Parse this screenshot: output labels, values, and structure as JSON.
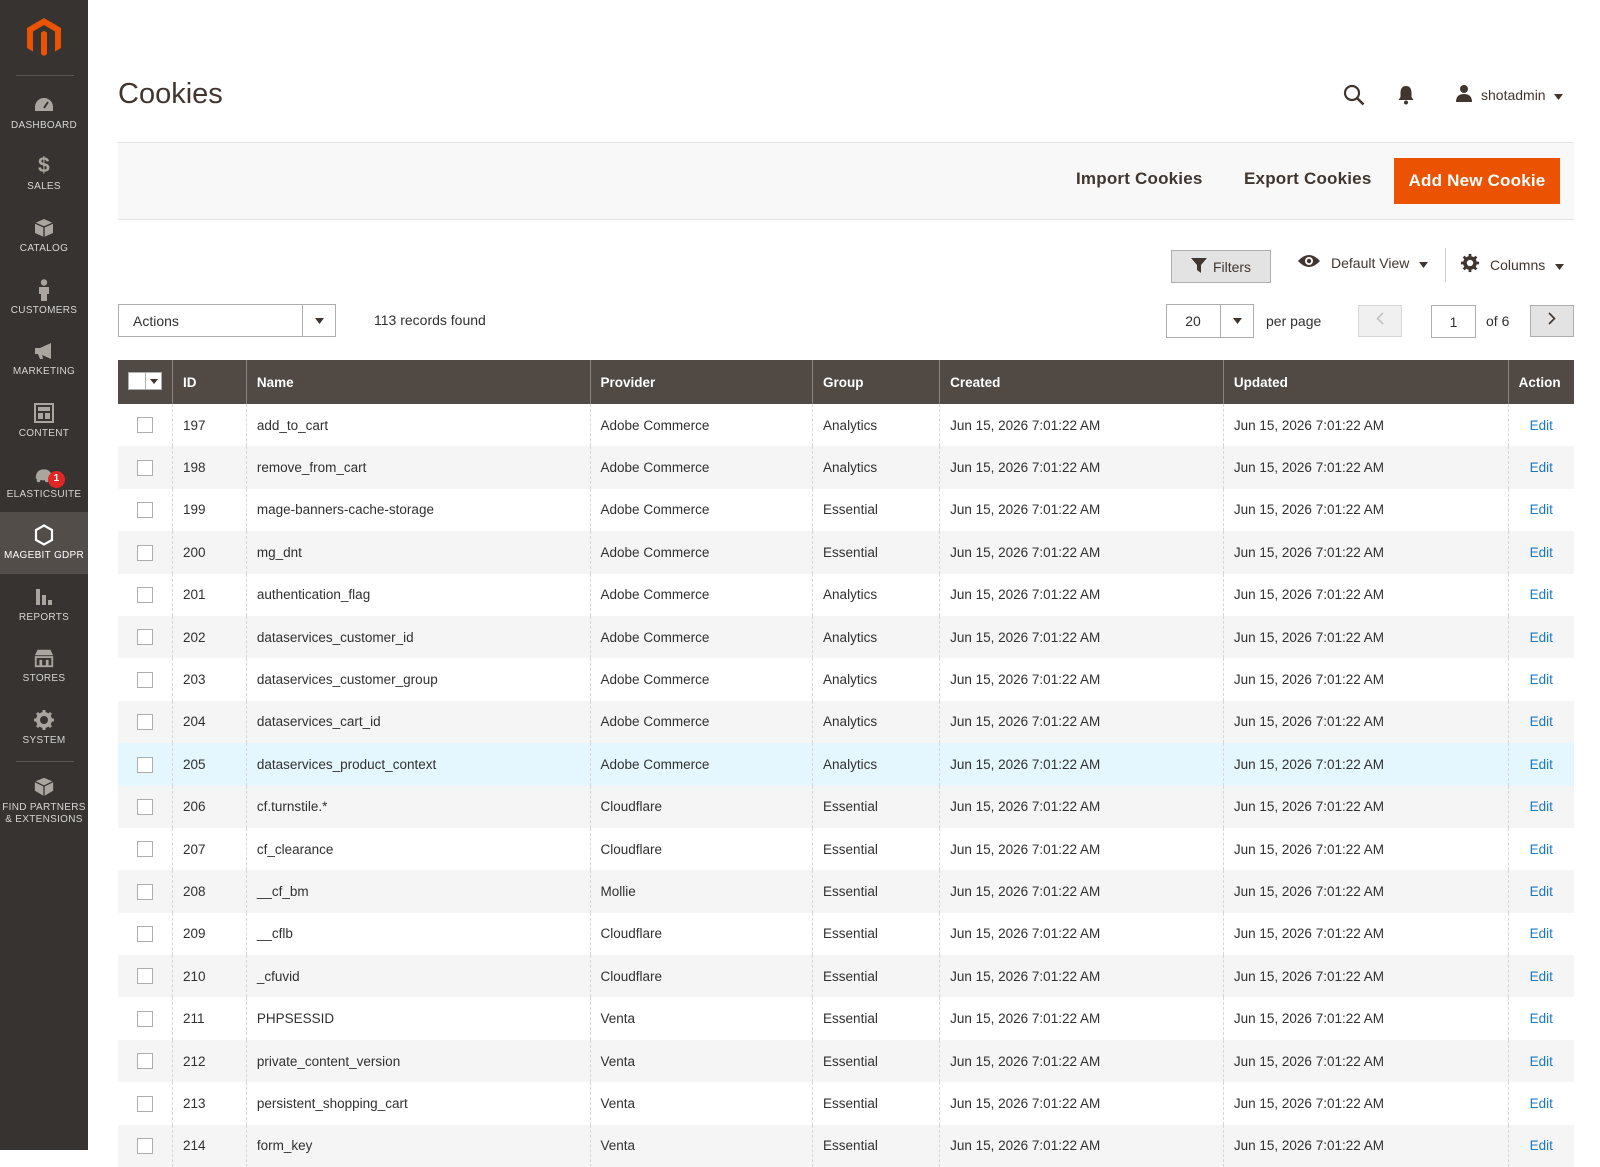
{
  "sidebar": {
    "items": [
      {
        "label": "DASHBOARD",
        "icon": "dashboard-icon"
      },
      {
        "label": "SALES",
        "icon": "dollar-icon"
      },
      {
        "label": "CATALOG",
        "icon": "box-icon"
      },
      {
        "label": "CUSTOMERS",
        "icon": "person-icon"
      },
      {
        "label": "MARKETING",
        "icon": "megaphone-icon"
      },
      {
        "label": "CONTENT",
        "icon": "layout-icon"
      },
      {
        "label": "ELASTICSUITE",
        "icon": "elasticsuite-icon",
        "badge": "1"
      },
      {
        "label": "MAGEBIT GDPR",
        "icon": "hexagon-icon"
      },
      {
        "label": "REPORTS",
        "icon": "bar-chart-icon"
      },
      {
        "label": "STORES",
        "icon": "store-icon"
      },
      {
        "label": "SYSTEM",
        "icon": "gear-icon"
      },
      {
        "label": "FIND PARTNERS\n& EXTENSIONS",
        "icon": "boxes-icon"
      }
    ]
  },
  "header": {
    "title": "Cookies",
    "user": "shotadmin"
  },
  "actions": {
    "import": "Import Cookies",
    "export": "Export Cookies",
    "add_new": "Add New Cookie"
  },
  "toolbar": {
    "filters": "Filters",
    "view": "Default View",
    "columns": "Columns",
    "mass_actions": "Actions",
    "records": "113 records found",
    "per_page_value": "20",
    "per_page_label": "per page",
    "page": "1",
    "of_pages": "of 6"
  },
  "grid": {
    "columns": [
      "ID",
      "Name",
      "Provider",
      "Group",
      "Created",
      "Updated",
      "Action"
    ],
    "rows": [
      {
        "id": "197",
        "name": "add_to_cart",
        "provider": "Adobe Commerce",
        "group": "Analytics",
        "created": "Jun 15, 2026 7:01:22 AM",
        "updated": "Jun 15, 2026 7:01:22 AM",
        "action": "Edit"
      },
      {
        "id": "198",
        "name": "remove_from_cart",
        "provider": "Adobe Commerce",
        "group": "Analytics",
        "created": "Jun 15, 2026 7:01:22 AM",
        "updated": "Jun 15, 2026 7:01:22 AM",
        "action": "Edit"
      },
      {
        "id": "199",
        "name": "mage-banners-cache-storage",
        "provider": "Adobe Commerce",
        "group": "Essential",
        "created": "Jun 15, 2026 7:01:22 AM",
        "updated": "Jun 15, 2026 7:01:22 AM",
        "action": "Edit"
      },
      {
        "id": "200",
        "name": "mg_dnt",
        "provider": "Adobe Commerce",
        "group": "Essential",
        "created": "Jun 15, 2026 7:01:22 AM",
        "updated": "Jun 15, 2026 7:01:22 AM",
        "action": "Edit"
      },
      {
        "id": "201",
        "name": "authentication_flag",
        "provider": "Adobe Commerce",
        "group": "Analytics",
        "created": "Jun 15, 2026 7:01:22 AM",
        "updated": "Jun 15, 2026 7:01:22 AM",
        "action": "Edit"
      },
      {
        "id": "202",
        "name": "dataservices_customer_id",
        "provider": "Adobe Commerce",
        "group": "Analytics",
        "created": "Jun 15, 2026 7:01:22 AM",
        "updated": "Jun 15, 2026 7:01:22 AM",
        "action": "Edit"
      },
      {
        "id": "203",
        "name": "dataservices_customer_group",
        "provider": "Adobe Commerce",
        "group": "Analytics",
        "created": "Jun 15, 2026 7:01:22 AM",
        "updated": "Jun 15, 2026 7:01:22 AM",
        "action": "Edit"
      },
      {
        "id": "204",
        "name": "dataservices_cart_id",
        "provider": "Adobe Commerce",
        "group": "Analytics",
        "created": "Jun 15, 2026 7:01:22 AM",
        "updated": "Jun 15, 2026 7:01:22 AM",
        "action": "Edit"
      },
      {
        "id": "205",
        "name": "dataservices_product_context",
        "provider": "Adobe Commerce",
        "group": "Analytics",
        "created": "Jun 15, 2026 7:01:22 AM",
        "updated": "Jun 15, 2026 7:01:22 AM",
        "action": "Edit"
      },
      {
        "id": "206",
        "name": "cf.turnstile.*",
        "provider": "Cloudflare",
        "group": "Essential",
        "created": "Jun 15, 2026 7:01:22 AM",
        "updated": "Jun 15, 2026 7:01:22 AM",
        "action": "Edit"
      },
      {
        "id": "207",
        "name": "cf_clearance",
        "provider": "Cloudflare",
        "group": "Essential",
        "created": "Jun 15, 2026 7:01:22 AM",
        "updated": "Jun 15, 2026 7:01:22 AM",
        "action": "Edit"
      },
      {
        "id": "208",
        "name": "__cf_bm",
        "provider": "Mollie",
        "group": "Essential",
        "created": "Jun 15, 2026 7:01:22 AM",
        "updated": "Jun 15, 2026 7:01:22 AM",
        "action": "Edit"
      },
      {
        "id": "209",
        "name": "__cflb",
        "provider": "Cloudflare",
        "group": "Essential",
        "created": "Jun 15, 2026 7:01:22 AM",
        "updated": "Jun 15, 2026 7:01:22 AM",
        "action": "Edit"
      },
      {
        "id": "210",
        "name": "_cfuvid",
        "provider": "Cloudflare",
        "group": "Essential",
        "created": "Jun 15, 2026 7:01:22 AM",
        "updated": "Jun 15, 2026 7:01:22 AM",
        "action": "Edit"
      },
      {
        "id": "211",
        "name": "PHPSESSID",
        "provider": "Venta",
        "group": "Essential",
        "created": "Jun 15, 2026 7:01:22 AM",
        "updated": "Jun 15, 2026 7:01:22 AM",
        "action": "Edit"
      },
      {
        "id": "212",
        "name": "private_content_version",
        "provider": "Venta",
        "group": "Essential",
        "created": "Jun 15, 2026 7:01:22 AM",
        "updated": "Jun 15, 2026 7:01:22 AM",
        "action": "Edit"
      },
      {
        "id": "213",
        "name": "persistent_shopping_cart",
        "provider": "Venta",
        "group": "Essential",
        "created": "Jun 15, 2026 7:01:22 AM",
        "updated": "Jun 15, 2026 7:01:22 AM",
        "action": "Edit"
      },
      {
        "id": "214",
        "name": "form_key",
        "provider": "Venta",
        "group": "Essential",
        "created": "Jun 15, 2026 7:01:22 AM",
        "updated": "Jun 15, 2026 7:01:22 AM",
        "action": "Edit"
      }
    ]
  },
  "colors": {
    "sidebar_bg": "#373330",
    "primary": "#eb5202",
    "link": "#1979c3",
    "header_bg": "#514943"
  }
}
